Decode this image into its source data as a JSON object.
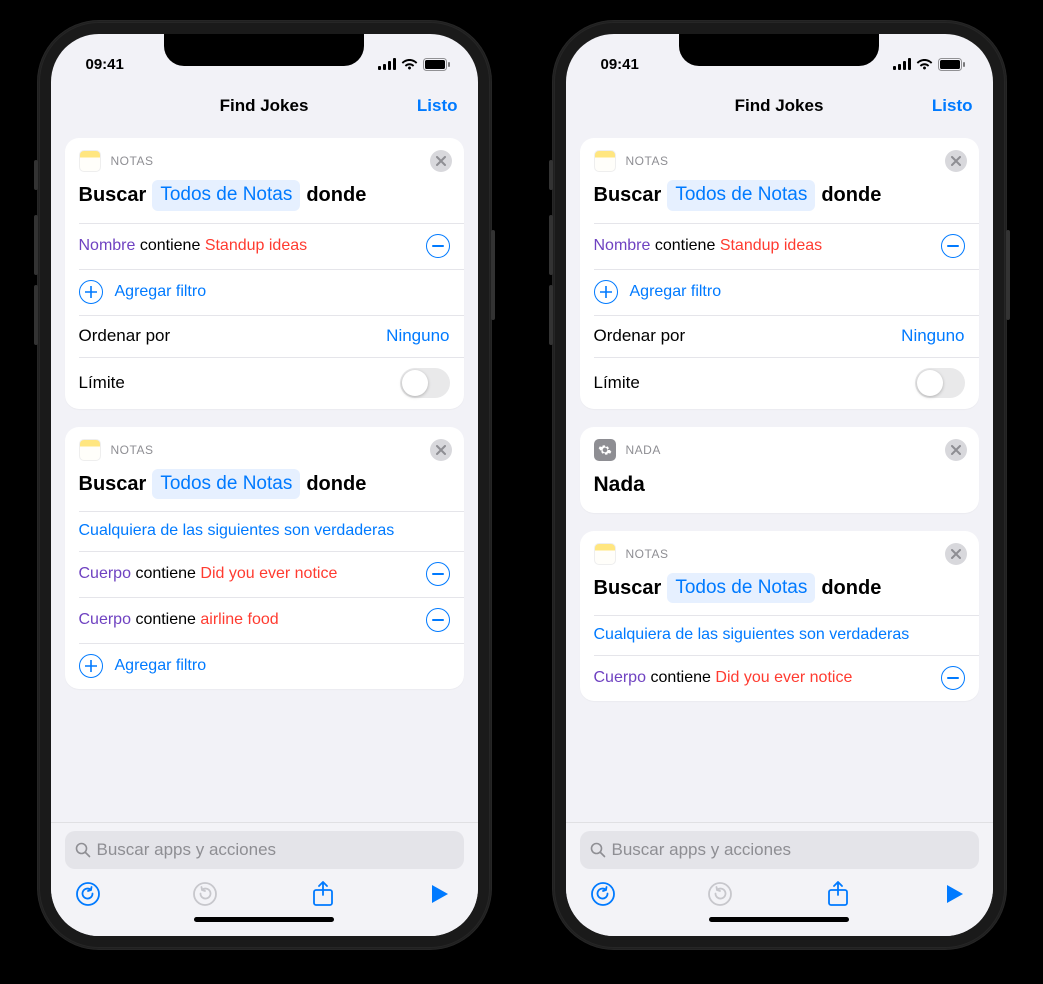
{
  "status": {
    "time": "09:41"
  },
  "nav": {
    "title": "Find Jokes",
    "done": "Listo"
  },
  "card_notes": {
    "app_label": "NOTAS",
    "search_word": "Buscar",
    "pill": "Todos de Notas",
    "where": "donde",
    "filter_name": {
      "param": "Nombre",
      "op": "contiene",
      "val": "Standup ideas"
    },
    "add_filter": "Agregar filtro",
    "sort_label": "Ordenar por",
    "sort_value": "Ninguno",
    "limit_label": "Límite"
  },
  "card_body": {
    "app_label": "NOTAS",
    "search_word": "Buscar",
    "pill": "Todos de Notas",
    "where": "donde",
    "any_true": "Cualquiera de las siguientes son verdaderas",
    "f1": {
      "param": "Cuerpo",
      "op": "contiene",
      "val": "Did you ever notice"
    },
    "f2": {
      "param": "Cuerpo",
      "op": "contiene",
      "val": "airline food"
    },
    "add_filter": "Agregar filtro"
  },
  "card_nothing": {
    "app_label": "NADA",
    "title": "Nada"
  },
  "search_placeholder": "Buscar apps y acciones"
}
